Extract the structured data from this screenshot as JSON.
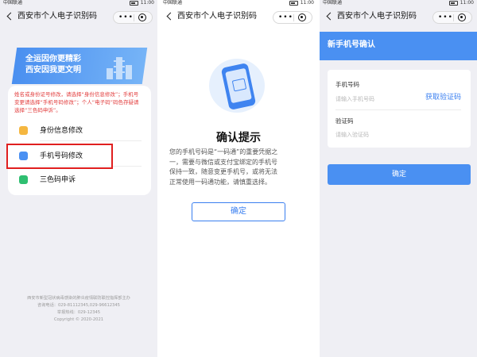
{
  "status": {
    "carrier": "中国联通",
    "time": "11:00"
  },
  "navbar": {
    "title": "西安市个人电子识别码",
    "more_glyph": "•••"
  },
  "screen1": {
    "banner": {
      "line1": "全运因你更精彩",
      "line2": "西安因我更文明"
    },
    "notice_lines": [
      "姓名或身份证号修改，请选择“身份信息修改”；手机号",
      "变更请选择“手机号码修改”；个人“电子码”码色存疑请",
      "选择“三色码申诉”。"
    ],
    "menu": [
      {
        "label": "身份信息修改",
        "icon": "id-card-icon",
        "color": "#f5b740"
      },
      {
        "label": "手机号码修改",
        "icon": "phone-icon",
        "color": "#4a90f2"
      },
      {
        "label": "三色码申诉",
        "icon": "qrcode-icon",
        "color": "#2fbf71"
      }
    ],
    "footer_lines": [
      "西安市新型冠状病毒感染的肺炎疫情联防联控指挥部主办",
      "咨询电话：029-81112345,029-96612345",
      "举报热线：029-12345",
      "Copyright © 2020-2021"
    ]
  },
  "screen2": {
    "title": "确认提示",
    "desc_lines": [
      "您的手机号码是“一码通”的重要凭据之",
      "一，需要与微信或支付宝绑定的手机号",
      "保持一致，随意变更手机号，或将无法",
      "正常使用一码通功能，请慎重选择。"
    ],
    "confirm_label": "确定"
  },
  "screen3": {
    "header": "新手机号确认",
    "phone_label": "手机号码",
    "phone_placeholder": "请输入手机号码",
    "get_code_label": "获取验证码",
    "code_label": "验证码",
    "code_placeholder": "请输入验证码",
    "confirm_label": "确定"
  },
  "colors": {
    "accent": "#4a90f2",
    "warning": "#e23b3b",
    "highlight": "#e01f1f"
  }
}
